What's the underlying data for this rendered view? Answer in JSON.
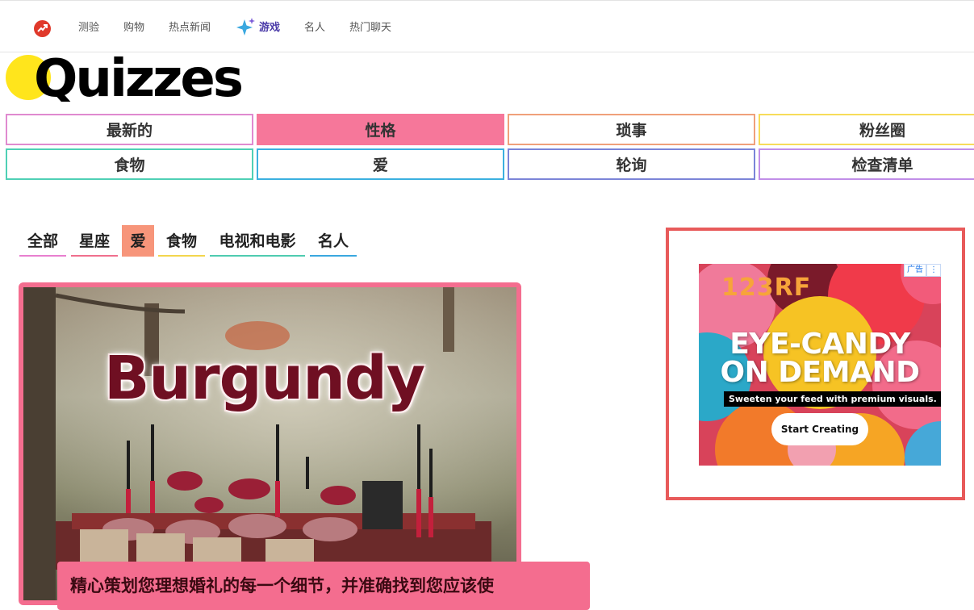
{
  "topnav": {
    "items": [
      {
        "label": "测验"
      },
      {
        "label": "购物"
      },
      {
        "label": "热点新闻"
      },
      {
        "label": "游戏"
      },
      {
        "label": "名人"
      },
      {
        "label": "热门聊天"
      }
    ],
    "active_index": 3
  },
  "logo": {
    "text": "Quizzes"
  },
  "categories": [
    {
      "label": "最新的",
      "color": "#e08ad0"
    },
    {
      "label": "性格",
      "color": "#f6779a"
    },
    {
      "label": "琐事",
      "color": "#f0a07a"
    },
    {
      "label": "粉丝圈",
      "color": "#f7dc5a"
    },
    {
      "label": "食物",
      "color": "#4fd0b5"
    },
    {
      "label": "爱",
      "color": "#3bb0e0"
    },
    {
      "label": "轮询",
      "color": "#7b84d8"
    },
    {
      "label": "检查清单",
      "color": "#c18ee8"
    }
  ],
  "tabs": [
    {
      "label": "全部",
      "color": "#e87fcf"
    },
    {
      "label": "星座",
      "color": "#f06f8d"
    },
    {
      "label": "爱",
      "color": "#f7957a"
    },
    {
      "label": "食物",
      "color": "#f3d64d"
    },
    {
      "label": "电视和电影",
      "color": "#4fcbb0"
    },
    {
      "label": "名人",
      "color": "#3aa8df"
    }
  ],
  "active_tab": "爱",
  "card": {
    "image_title": "Burgundy",
    "caption": "精心策划您理想婚礼的每一个细节，并准确找到您应该使"
  },
  "ad": {
    "badge": "广告",
    "brand": "123RF",
    "headline_line1": "EYE-CANDY",
    "headline_line2": "ON DEMAND",
    "subline": "Sweeten your feed with premium visuals.",
    "cta": "Start Creating"
  }
}
